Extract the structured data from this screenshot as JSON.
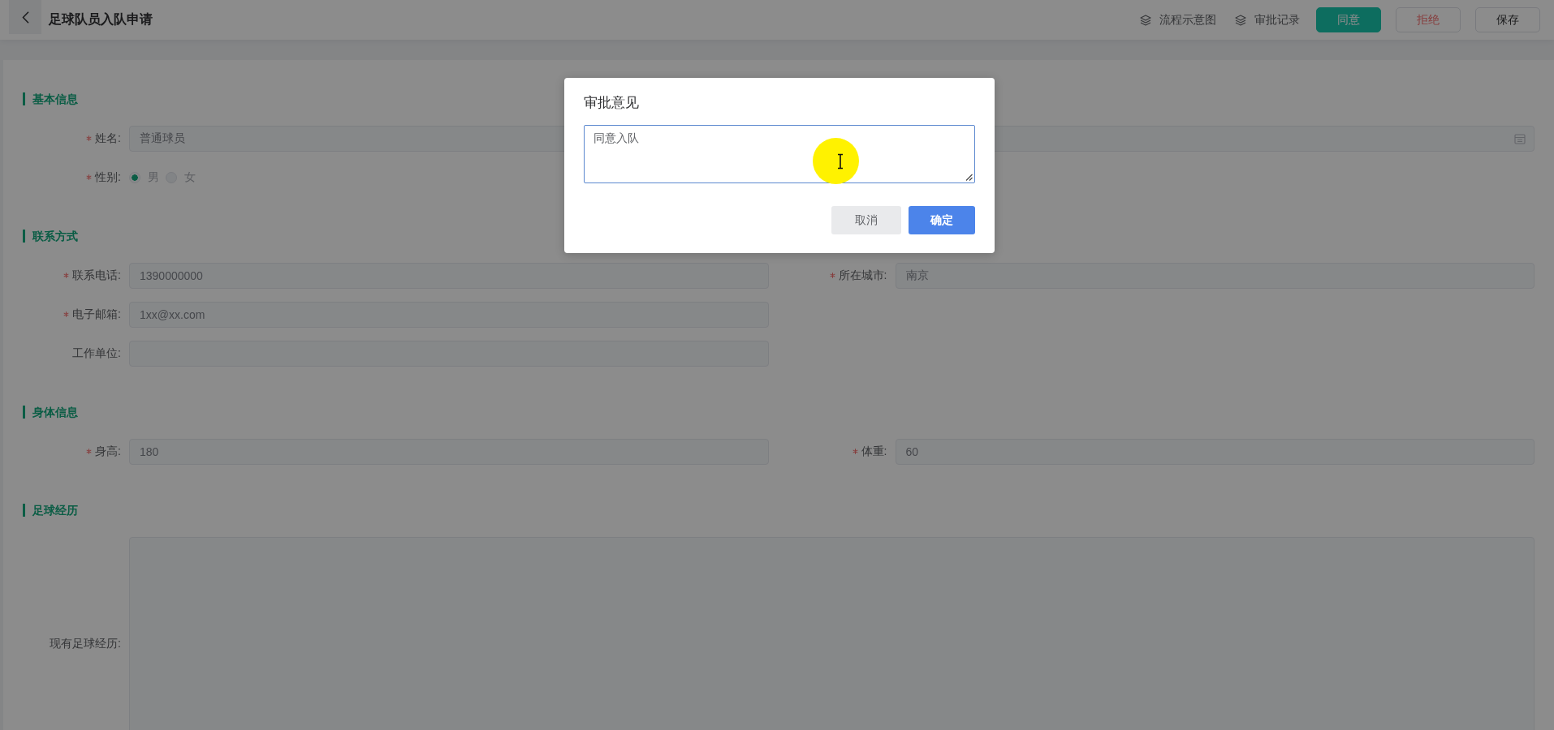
{
  "header": {
    "title": "足球队员入队申请",
    "links": [
      {
        "label": "流程示意图"
      },
      {
        "label": "审批记录"
      }
    ],
    "buttons": [
      {
        "label": "同意",
        "kind": "primary"
      },
      {
        "label": "拒绝",
        "kind": "danger"
      },
      {
        "label": "保存",
        "kind": "default"
      }
    ]
  },
  "form": {
    "disabled": true,
    "sections": [
      {
        "title": "基本信息",
        "rows": [
          [
            {
              "kind": "input",
              "label": "姓名:",
              "required": true,
              "value": "普通球员"
            },
            {
              "kind": "date"
            }
          ],
          [
            {
              "kind": "radio",
              "label": "性别:",
              "required": true,
              "options": [
                {
                  "label": "男",
                  "selected": true
                },
                {
                  "label": "女",
                  "selected": false
                }
              ]
            }
          ]
        ]
      },
      {
        "title": "联系方式",
        "rows": [
          [
            {
              "kind": "input",
              "label": "联系电话:",
              "required": true,
              "value": "1390000000"
            },
            {
              "kind": "input",
              "label": "所在城市:",
              "required": true,
              "value": "南京"
            }
          ],
          [
            {
              "kind": "input",
              "label": "电子邮箱:",
              "required": true,
              "value": "1xx@xx.com"
            }
          ],
          [
            {
              "kind": "input",
              "label": "工作单位:",
              "required": false
            }
          ]
        ]
      },
      {
        "title": "身体信息",
        "rows": [
          [
            {
              "kind": "input",
              "label": "身高:",
              "required": true,
              "value": "180"
            },
            {
              "kind": "input",
              "label": "体重:",
              "required": true,
              "value": "60"
            }
          ]
        ]
      },
      {
        "title": "足球经历",
        "rows": [
          [
            {
              "kind": "textarea",
              "label": "现有足球经历:",
              "required": false
            }
          ]
        ]
      }
    ]
  },
  "dialog": {
    "title": "审批意见",
    "comment": {
      "value": "同意入队",
      "focused": true
    },
    "buttons": [
      {
        "label": "取消",
        "kind": "default"
      },
      {
        "label": "确定",
        "kind": "primary"
      }
    ]
  }
}
